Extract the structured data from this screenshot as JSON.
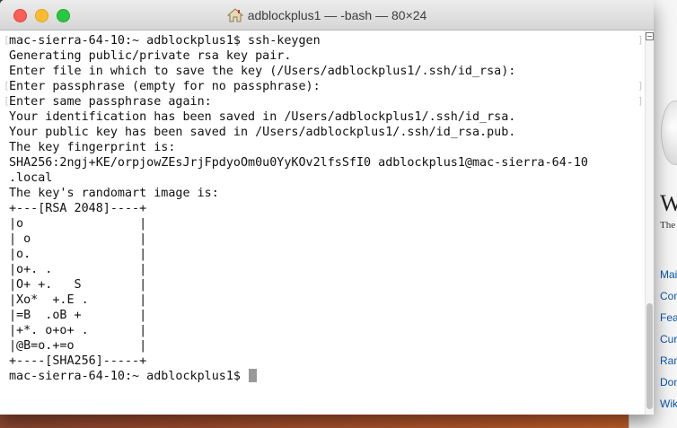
{
  "window": {
    "title": "adblockplus1 — -bash — 80×24",
    "title_icon": "home-icon"
  },
  "terminal": {
    "lines": [
      "mac-sierra-64-10:~ adblockplus1$ ssh-keygen",
      "Generating public/private rsa key pair.",
      "Enter file in which to save the key (/Users/adblockplus1/.ssh/id_rsa):",
      "Enter passphrase (empty for no passphrase):",
      "Enter same passphrase again:",
      "Your identification has been saved in /Users/adblockplus1/.ssh/id_rsa.",
      "Your public key has been saved in /Users/adblockplus1/.ssh/id_rsa.pub.",
      "The key fingerprint is:",
      "SHA256:2ngj+KE/orpjowZEsJrjFpdyoOm0u0YyKOv2lfsSfI0 adblockplus1@mac-sierra-64-10",
      ".local",
      "The key's randomart image is:",
      "+---[RSA 2048]----+",
      "|o                |",
      "| o               |",
      "|o.               |",
      "|o+. .            |",
      "|O+ +.   S        |",
      "|Xo*  +.E .       |",
      "|=B  .oB +        |",
      "|+*. o+o+ .       |",
      "|@B=o.+=o         |",
      "+----[SHA256]-----+"
    ],
    "prompt": "mac-sierra-64-10:~ adblockplus1$ "
  },
  "background_window": {
    "title_fragment": "W",
    "subtitle_fragment": "The",
    "nav_items": [
      "Mai",
      "Con",
      "Fea",
      "Cur",
      "Ran",
      "Don",
      "Wik"
    ]
  },
  "colors": {
    "close": "#fd5e55",
    "minimize": "#fdbc2e",
    "zoom": "#28c841",
    "text": "#111111",
    "link": "#0b57a8"
  }
}
